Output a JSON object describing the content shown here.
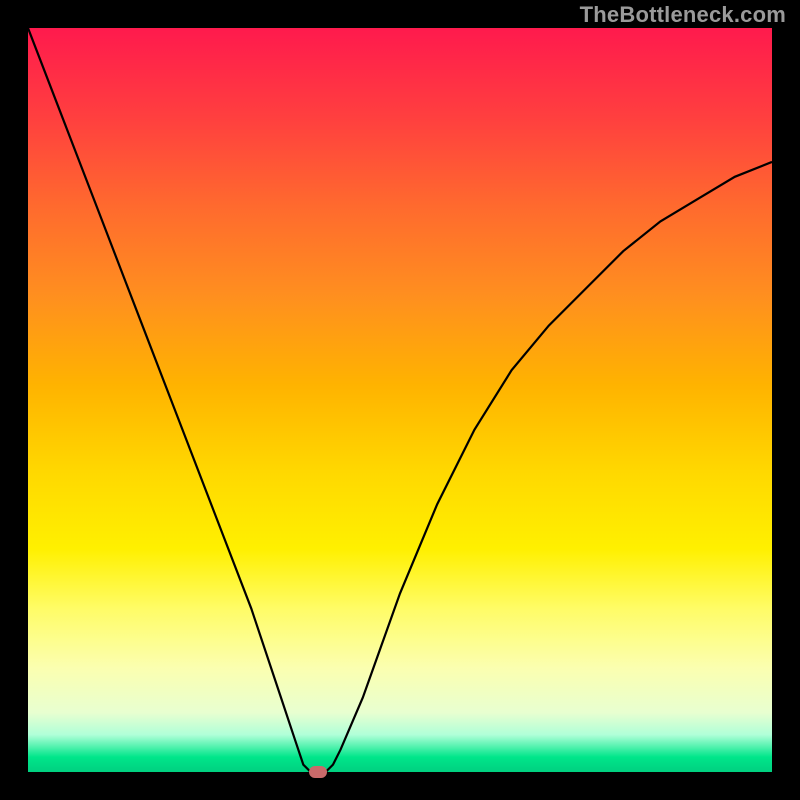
{
  "watermark": "TheBottleneck.com",
  "chart_data": {
    "type": "line",
    "title": "",
    "xlabel": "",
    "ylabel": "",
    "xlim": [
      0,
      100
    ],
    "ylim": [
      0,
      100
    ],
    "x": [
      0,
      5,
      10,
      15,
      20,
      25,
      30,
      34,
      36,
      37,
      38,
      39,
      40,
      41,
      42,
      45,
      50,
      55,
      60,
      65,
      70,
      75,
      80,
      85,
      90,
      95,
      100
    ],
    "values": [
      100,
      87,
      74,
      61,
      48,
      35,
      22,
      10,
      4,
      1,
      0,
      0,
      0,
      1,
      3,
      10,
      24,
      36,
      46,
      54,
      60,
      65,
      70,
      74,
      77,
      80,
      82
    ],
    "marker": {
      "x": 39,
      "y": 0
    },
    "annotations": []
  },
  "colors": {
    "marker": "#c96a6a",
    "curve": "#000000"
  }
}
